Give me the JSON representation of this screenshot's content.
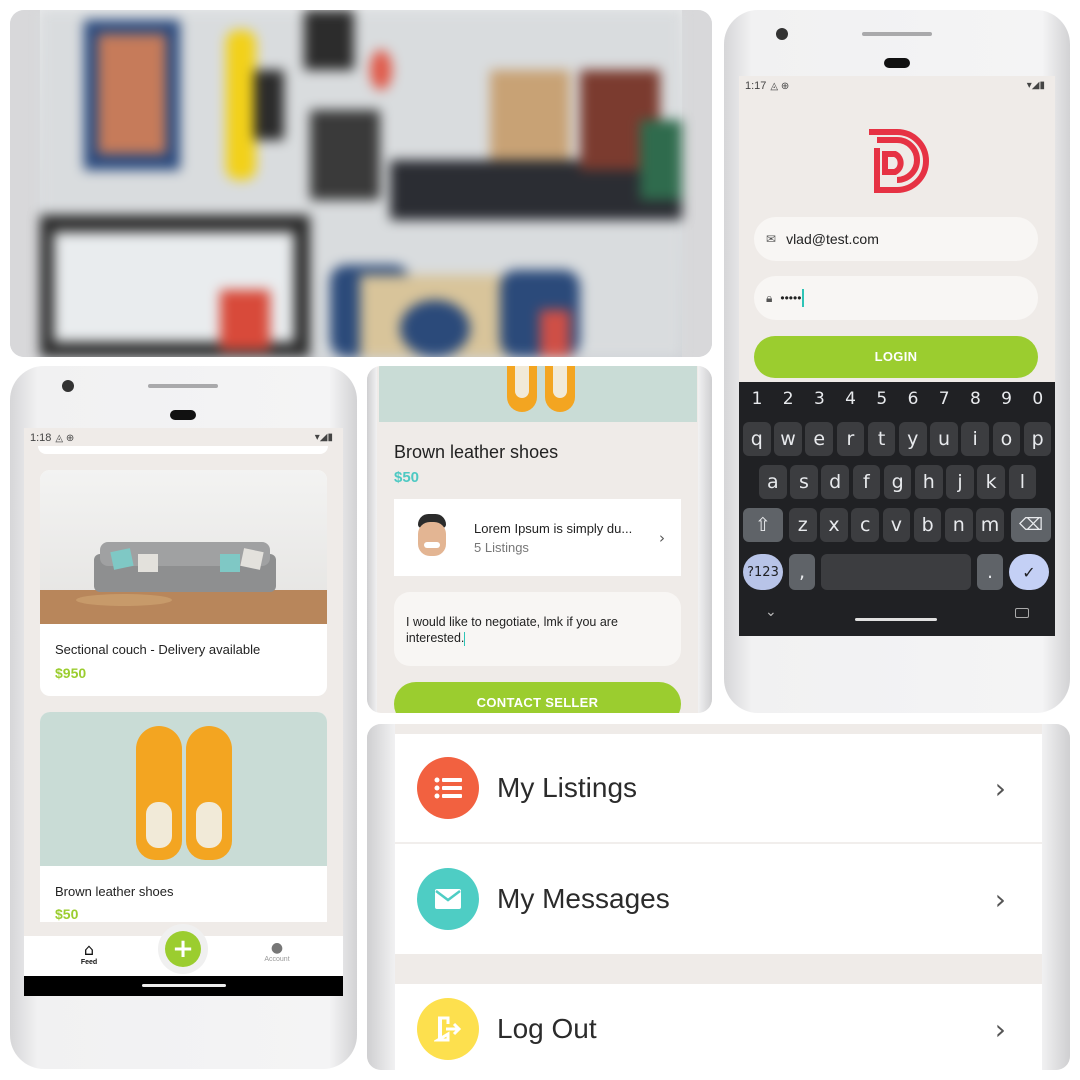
{
  "login": {
    "status_time": "1:17",
    "email_value": "vlad@test.com",
    "password_value": "•••••",
    "login_label": "LOGIN",
    "keyboard": {
      "numbers": [
        "1",
        "2",
        "3",
        "4",
        "5",
        "6",
        "7",
        "8",
        "9",
        "0"
      ],
      "row1": [
        "q",
        "w",
        "e",
        "r",
        "t",
        "y",
        "u",
        "i",
        "o",
        "p"
      ],
      "row2": [
        "a",
        "s",
        "d",
        "f",
        "g",
        "h",
        "j",
        "k",
        "l"
      ],
      "row3": [
        "z",
        "x",
        "c",
        "v",
        "b",
        "n",
        "m"
      ],
      "sym_label": "?123",
      "comma": ",",
      "period": ".",
      "shift_icon": "⇧",
      "delete_icon": "⌫",
      "enter_icon": "✓",
      "hide_icon": "⌄"
    }
  },
  "feed": {
    "status_time": "1:18",
    "listings": [
      {
        "title": "Sectional couch - Delivery available",
        "price": "$950"
      },
      {
        "title": "Brown leather shoes",
        "price": "$50"
      }
    ],
    "nav": {
      "feed_label": "Feed",
      "account_label": "Account",
      "add_icon": "+"
    }
  },
  "detail": {
    "title": "Brown leather shoes",
    "price": "$50",
    "seller_name": "Lorem Ipsum is simply du...",
    "seller_listings": "5 Listings",
    "message": "I would like to negotiate, lmk if you are interested.",
    "contact_label": "CONTACT SELLER"
  },
  "account": {
    "items": [
      {
        "label": "My Listings",
        "icon": "list-icon",
        "color": "#f26140"
      },
      {
        "label": "My Messages",
        "icon": "mail-icon",
        "color": "#4ecdc4"
      },
      {
        "label": "Log Out",
        "icon": "logout-icon",
        "color": "#fde04e"
      }
    ]
  },
  "colors": {
    "accent": "#9bcd2f",
    "teal": "#4ec9c3",
    "brand_red": "#e63244"
  }
}
